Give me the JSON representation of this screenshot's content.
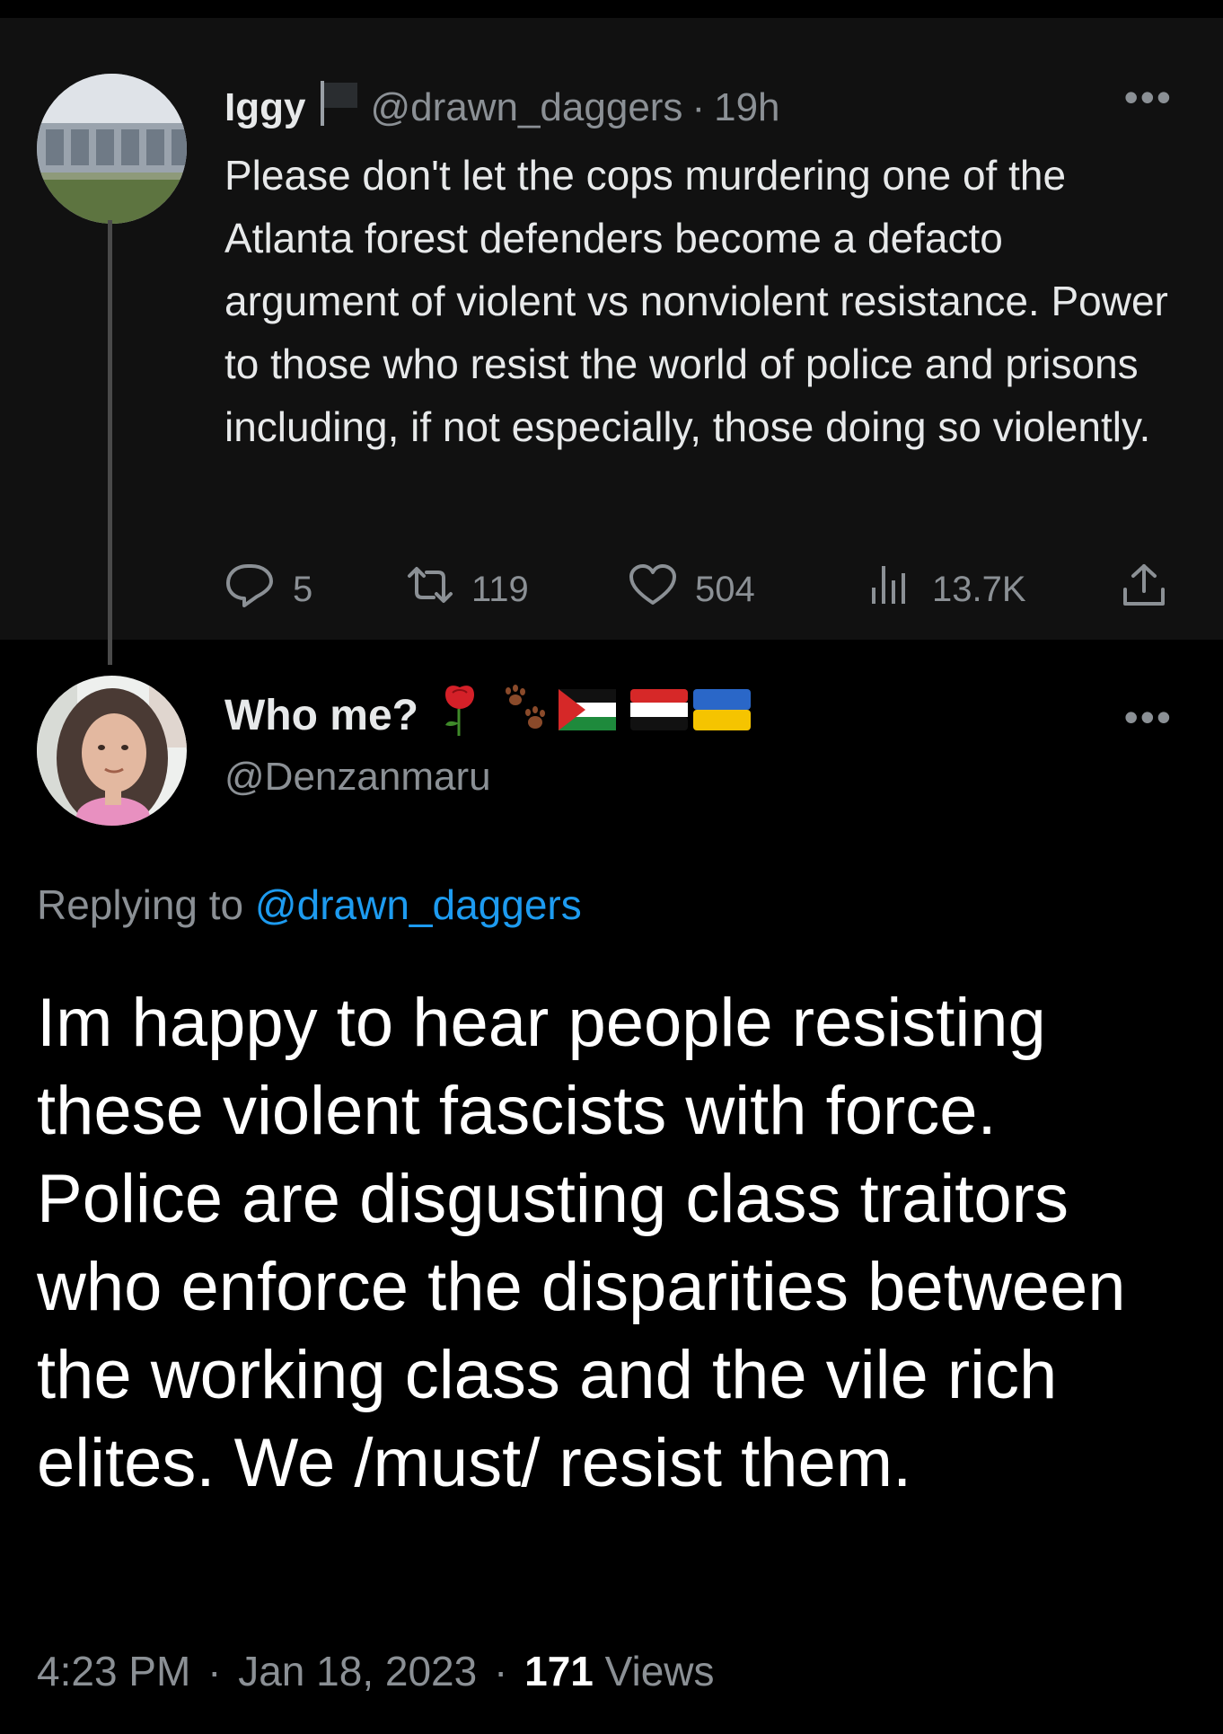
{
  "parent_tweet": {
    "author_name": "Iggy",
    "handle": "@drawn_daggers",
    "separator": "·",
    "time": "19h",
    "more_label": "•••",
    "text": "Please don't let the cops murdering one of the Atlanta forest defenders become a defacto argument of violent vs nonviolent resistance. Power to those who resist the world of police and prisons including, if not especially, those doing so violently.",
    "replies": "5",
    "retweets": "119",
    "likes": "504",
    "views": "13.7K"
  },
  "reply_tweet": {
    "author_name": "Who me?",
    "handle": "@Denzanmaru",
    "more_label": "•••",
    "replying_prefix": "Replying to",
    "replying_to": "@drawn_daggers",
    "text": "Im happy to hear people resisting these violent fascists with force. Police are disgusting class traitors who enforce the disparities between the working class and the vile rich elites. We /must/ resist them.",
    "time": "4:23 PM",
    "date": "Jan 18, 2023",
    "separator": "·",
    "views_count": "171",
    "views_label": "Views"
  },
  "icons": [
    "black-flag-icon",
    "reply-icon",
    "retweet-icon",
    "like-icon",
    "views-icon",
    "share-icon",
    "rose-icon",
    "paw-prints-icon",
    "palestine-flag-icon",
    "yemen-flag-icon",
    "ukraine-flag-icon"
  ],
  "colors": {
    "accent": "#1d9bf0",
    "muted": "#8b9095",
    "parent_bg": "#111111",
    "bg": "#000000"
  }
}
